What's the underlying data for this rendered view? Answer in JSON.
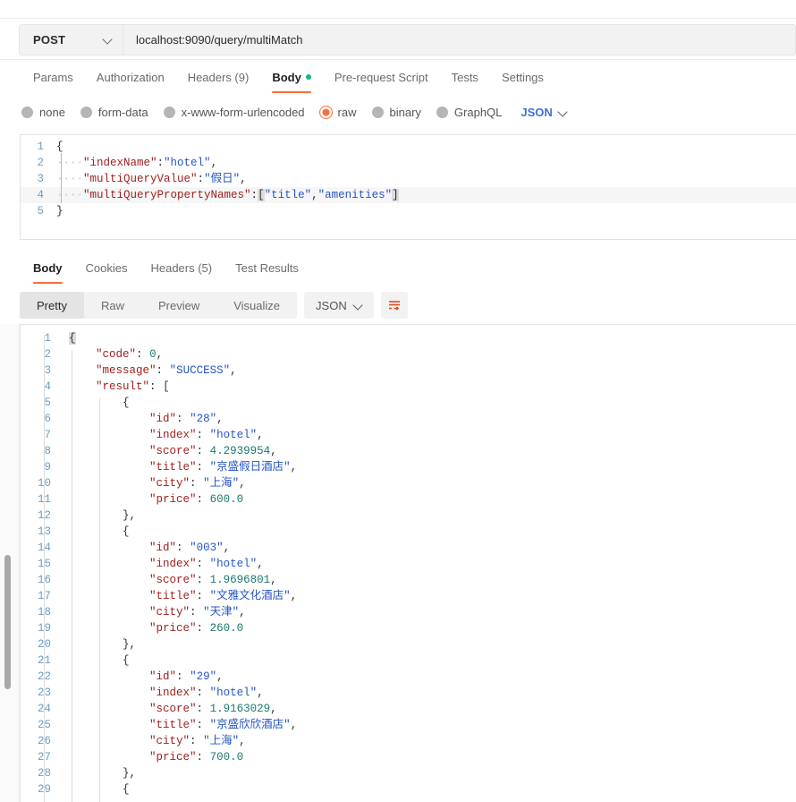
{
  "request": {
    "method": "POST",
    "url": "localhost:9090/query/multiMatch",
    "tabs": [
      {
        "label": "Params",
        "active": false,
        "dot": false
      },
      {
        "label": "Authorization",
        "active": false,
        "dot": false
      },
      {
        "label": "Headers (9)",
        "active": false,
        "dot": false
      },
      {
        "label": "Body",
        "active": true,
        "dot": true
      },
      {
        "label": "Pre-request Script",
        "active": false,
        "dot": false
      },
      {
        "label": "Tests",
        "active": false,
        "dot": false
      },
      {
        "label": "Settings",
        "active": false,
        "dot": false
      }
    ],
    "body_types": [
      {
        "label": "none",
        "selected": false
      },
      {
        "label": "form-data",
        "selected": false
      },
      {
        "label": "x-www-form-urlencoded",
        "selected": false
      },
      {
        "label": "raw",
        "selected": true
      },
      {
        "label": "binary",
        "selected": false
      },
      {
        "label": "GraphQL",
        "selected": false
      }
    ],
    "format_selected": "JSON",
    "body_lines": [
      {
        "n": "1",
        "text": "{"
      },
      {
        "n": "2",
        "text": "    \"indexName\":\"hotel\","
      },
      {
        "n": "3",
        "text": "    \"multiQueryValue\":\"假日\","
      },
      {
        "n": "4",
        "text": "    \"multiQueryPropertyNames\":[\"title\",\"amenities\"]"
      },
      {
        "n": "5",
        "text": "}"
      }
    ]
  },
  "response": {
    "tabs": [
      {
        "label": "Body",
        "active": true
      },
      {
        "label": "Cookies",
        "active": false
      },
      {
        "label": "Headers (5)",
        "active": false
      },
      {
        "label": "Test Results",
        "active": false
      }
    ],
    "view_modes": [
      {
        "label": "Pretty",
        "active": true
      },
      {
        "label": "Raw",
        "active": false
      },
      {
        "label": "Preview",
        "active": false
      },
      {
        "label": "Visualize",
        "active": false
      }
    ],
    "format_selected": "JSON",
    "wrap_icon": "word-wrap-icon",
    "body_lines": [
      {
        "n": "1",
        "text": "{"
      },
      {
        "n": "2",
        "text": "    \"code\": 0,"
      },
      {
        "n": "3",
        "text": "    \"message\": \"SUCCESS\","
      },
      {
        "n": "4",
        "text": "    \"result\": ["
      },
      {
        "n": "5",
        "text": "        {"
      },
      {
        "n": "6",
        "text": "            \"id\": \"28\","
      },
      {
        "n": "7",
        "text": "            \"index\": \"hotel\","
      },
      {
        "n": "8",
        "text": "            \"score\": 4.2939954,"
      },
      {
        "n": "9",
        "text": "            \"title\": \"京盛假日酒店\","
      },
      {
        "n": "10",
        "text": "            \"city\": \"上海\","
      },
      {
        "n": "11",
        "text": "            \"price\": 600.0"
      },
      {
        "n": "12",
        "text": "        },"
      },
      {
        "n": "13",
        "text": "        {"
      },
      {
        "n": "14",
        "text": "            \"id\": \"003\","
      },
      {
        "n": "15",
        "text": "            \"index\": \"hotel\","
      },
      {
        "n": "16",
        "text": "            \"score\": 1.9696801,"
      },
      {
        "n": "17",
        "text": "            \"title\": \"文雅文化酒店\","
      },
      {
        "n": "18",
        "text": "            \"city\": \"天津\","
      },
      {
        "n": "19",
        "text": "            \"price\": 260.0"
      },
      {
        "n": "20",
        "text": "        },"
      },
      {
        "n": "21",
        "text": "        {"
      },
      {
        "n": "22",
        "text": "            \"id\": \"29\","
      },
      {
        "n": "23",
        "text": "            \"index\": \"hotel\","
      },
      {
        "n": "24",
        "text": "            \"score\": 1.9163029,"
      },
      {
        "n": "25",
        "text": "            \"title\": \"京盛欣欣酒店\","
      },
      {
        "n": "26",
        "text": "            \"city\": \"上海\","
      },
      {
        "n": "27",
        "text": "            \"price\": 700.0"
      },
      {
        "n": "28",
        "text": "        },"
      },
      {
        "n": "29",
        "text": "        {"
      }
    ]
  },
  "colors": {
    "accent": "#ff6c37",
    "key": "#a02020",
    "string": "#2554c7",
    "number": "#1a7a6b",
    "linenum": "#6d9fc4",
    "status_dot": "#10b981",
    "format_blue": "#3f6fd6"
  }
}
